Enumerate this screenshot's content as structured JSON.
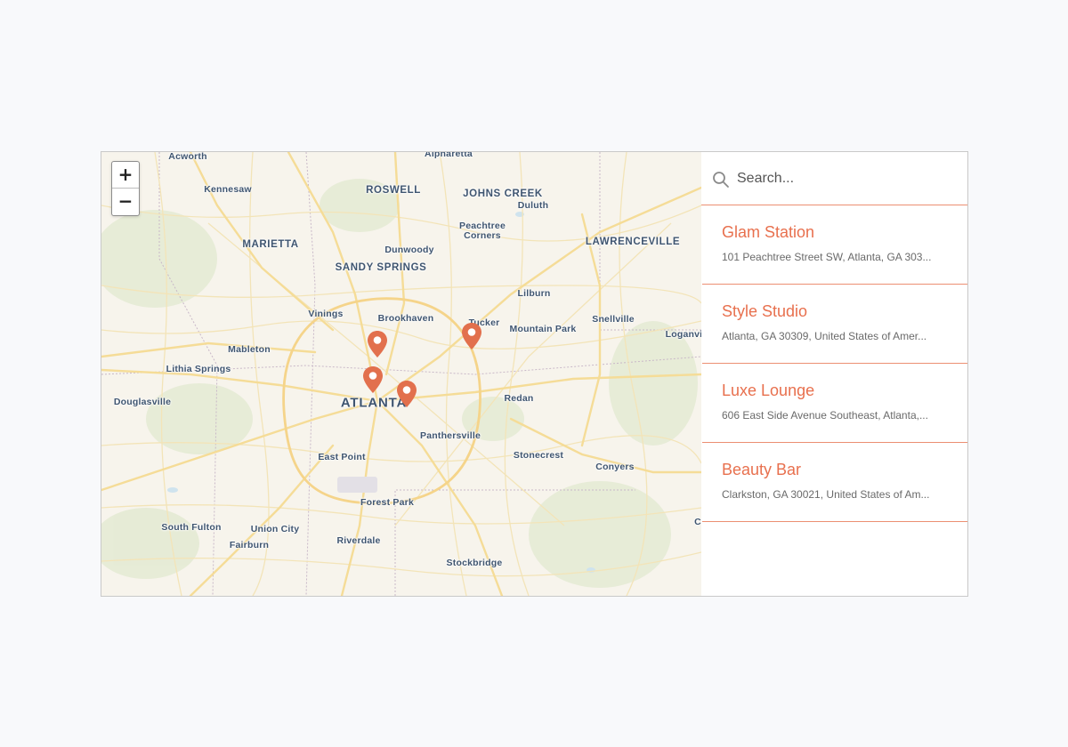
{
  "search": {
    "placeholder": "Search..."
  },
  "zoom": {
    "in_label": "+",
    "out_label": "−"
  },
  "map_labels": {
    "acworth": "Acworth",
    "alpharetta": "Alpharetta",
    "kennesaw": "Kennesaw",
    "roswell": "ROSWELL",
    "johns_creek": "JOHNS CREEK",
    "duluth": "Duluth",
    "marietta": "MARIETTA",
    "dunwoody": "Dunwoody",
    "peachtree_corners": "Peachtree Corners",
    "lawrenceville": "LAWRENCEVILLE",
    "sandy_springs": "SANDY SPRINGS",
    "lilburn": "Lilburn",
    "vinings": "Vinings",
    "brookhaven": "Brookhaven",
    "tucker": "Tucker",
    "snellville": "Snellville",
    "mountain_park": "Mountain Park",
    "loganville": "Loganvil",
    "mableton": "Mableton",
    "lithia_springs": "Lithia Springs",
    "atlanta": "ATLANTA",
    "redan": "Redan",
    "douglasville": "Douglasville",
    "panthersville": "Panthersville",
    "east_point": "East Point",
    "stonecrest": "Stonecrest",
    "conyers": "Conyers",
    "forest_park": "Forest Park",
    "south_fulton": "South Fulton",
    "union_city": "Union City",
    "fairburn": "Fairburn",
    "riverdale": "Riverdale",
    "stockbridge": "Stockbridge",
    "edge_c": "C"
  },
  "locations": [
    {
      "name": "Glam Station",
      "address": "101 Peachtree Street SW, Atlanta, GA 303..."
    },
    {
      "name": "Style Studio",
      "address": "Atlanta, GA 30309, United States of Amer..."
    },
    {
      "name": "Luxe Lounge",
      "address": "606 East Side Avenue Southeast, Atlanta,..."
    },
    {
      "name": "Beauty Bar",
      "address": "Clarkston, GA 30021, United States of Am..."
    }
  ],
  "colors": {
    "accent": "#e8704e",
    "divider": "#ec8f72",
    "marker": "#e2704d",
    "map_label": "#3f5570",
    "road": "#f5dc97"
  }
}
